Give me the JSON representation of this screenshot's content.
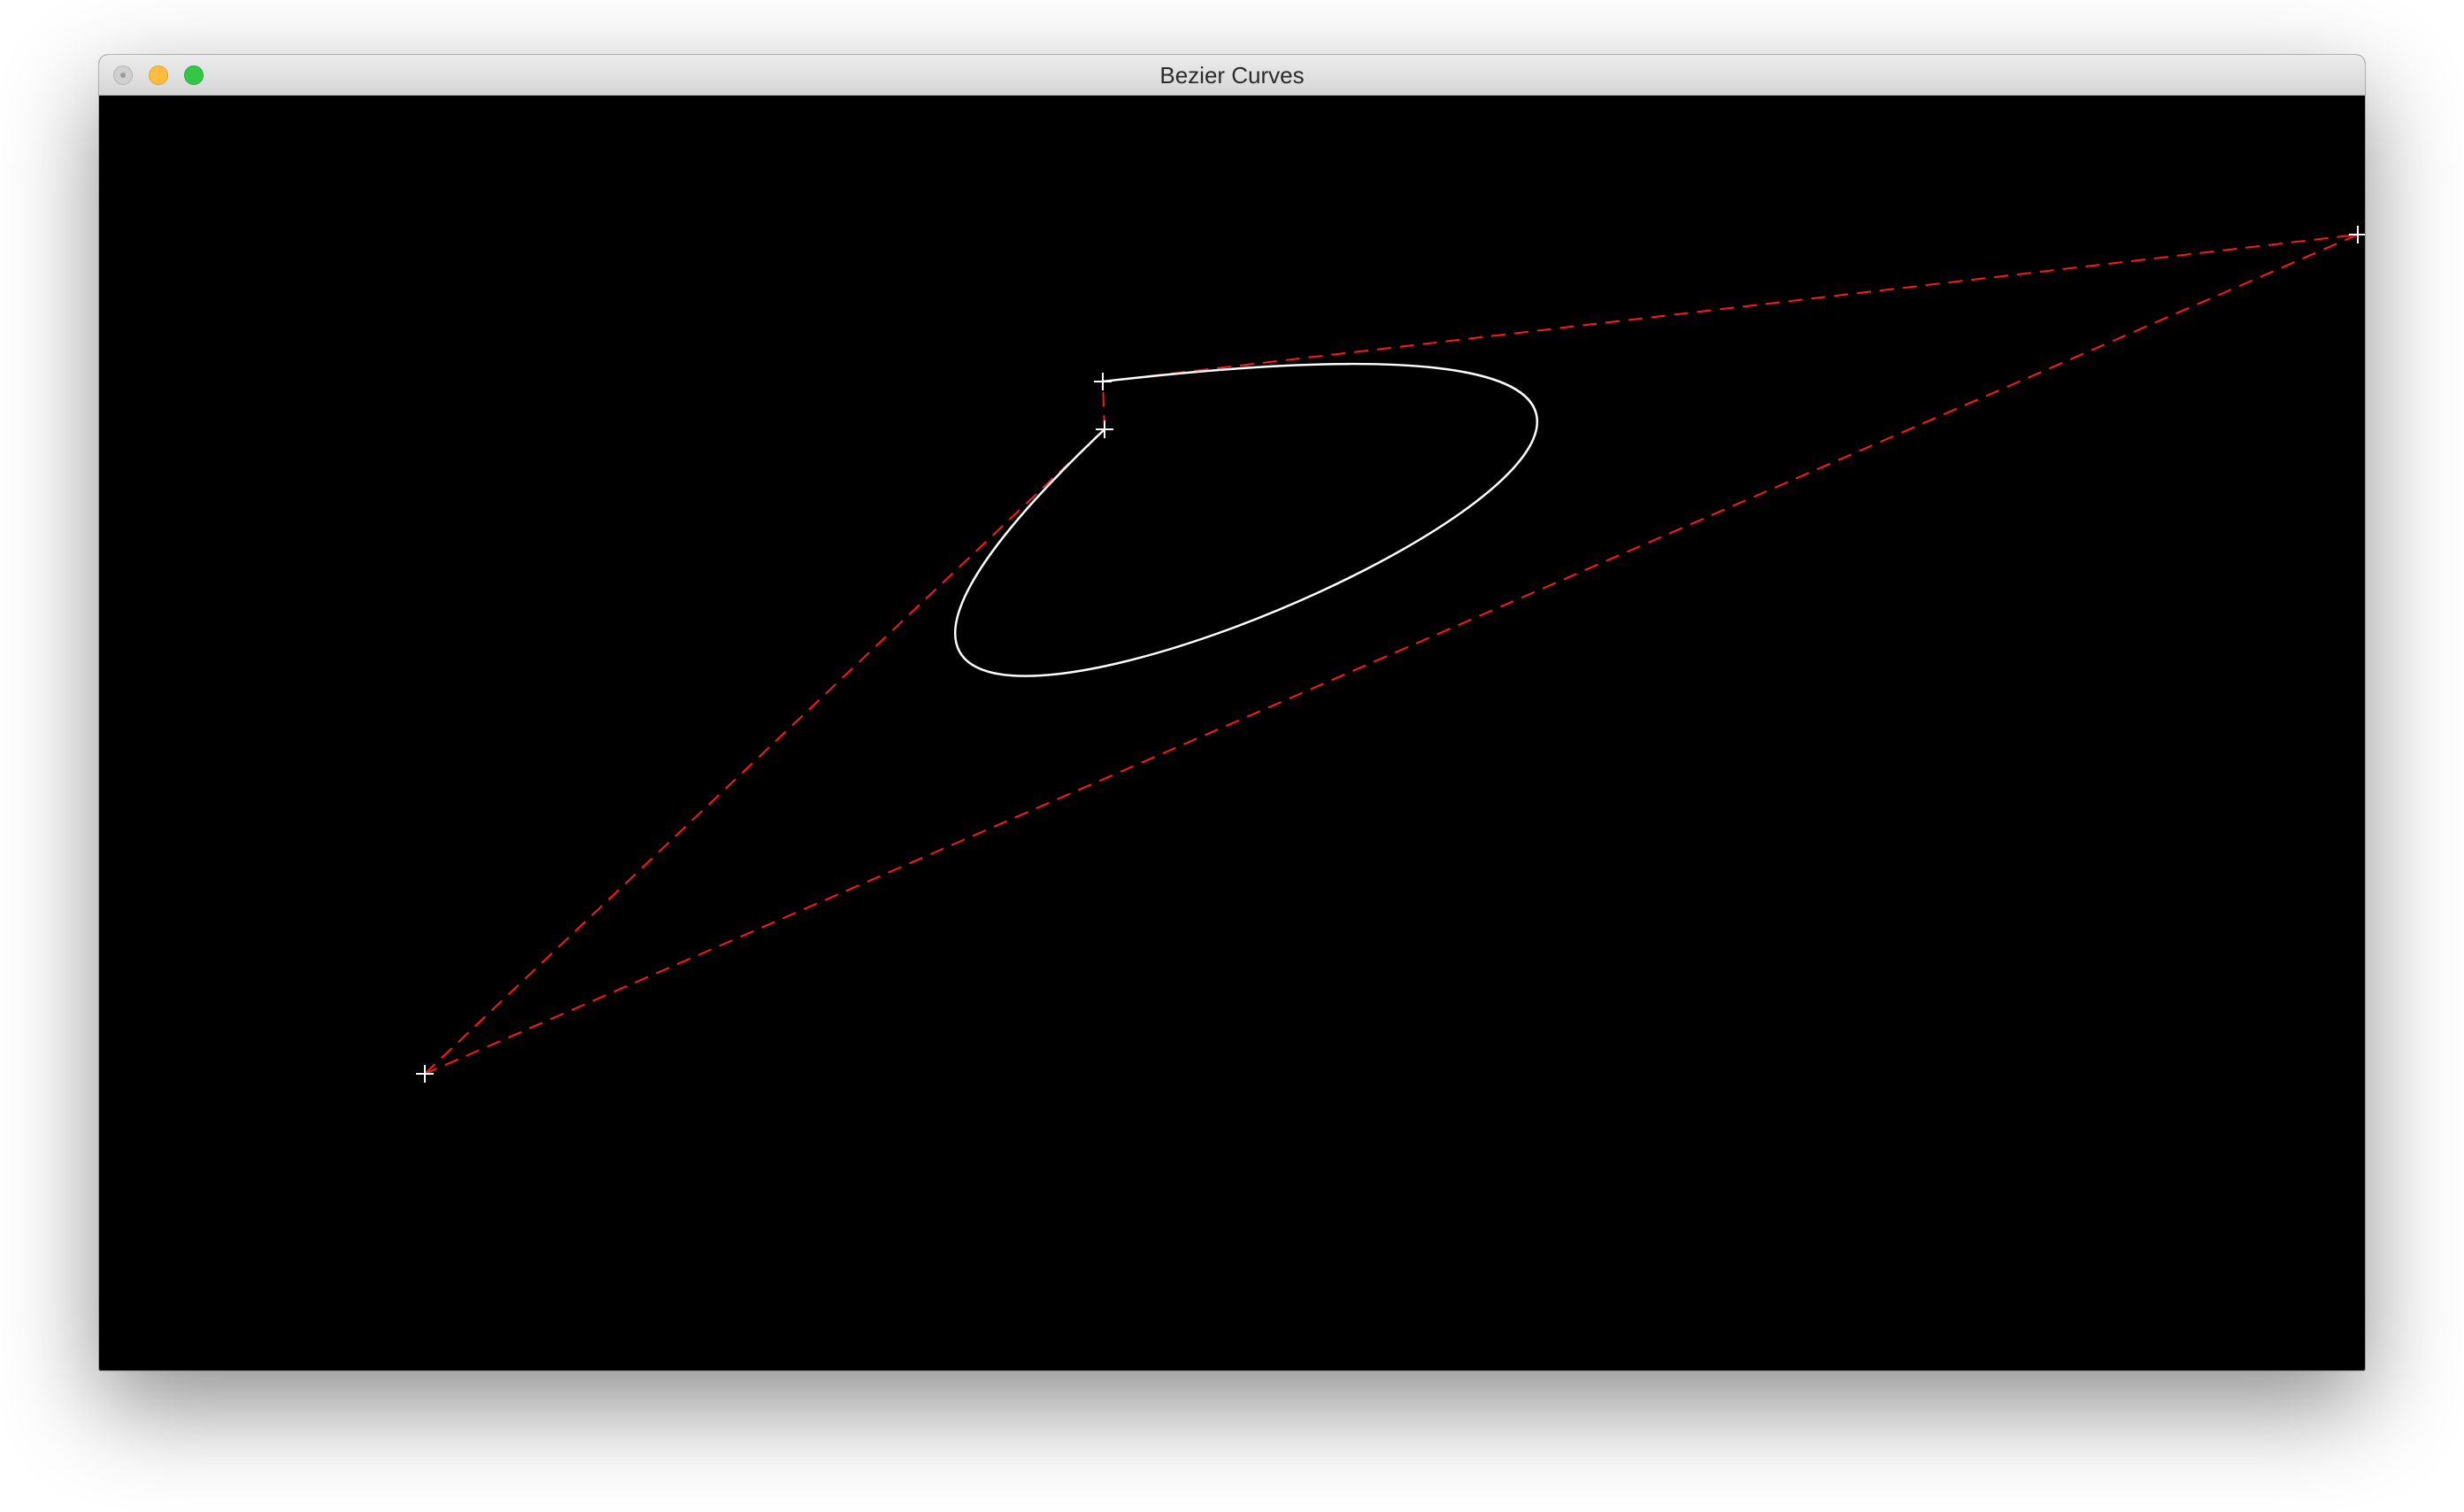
{
  "window": {
    "title": "Bezier Curves"
  },
  "colors": {
    "background": "#000000",
    "curve": "#ffffff",
    "control_polygon": "#ff1a1a",
    "control_point_marker": "#ffffff"
  },
  "icons": {
    "close": "close-button-icon",
    "minimize": "minimize-button-icon",
    "zoom": "zoom-button-icon",
    "control_point": "crosshair-plus-icon"
  }
}
